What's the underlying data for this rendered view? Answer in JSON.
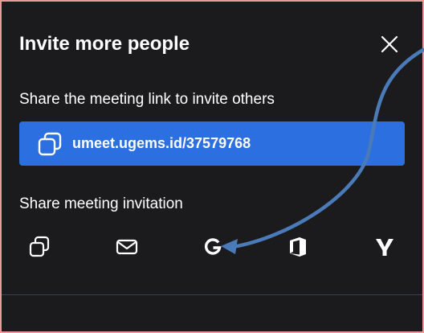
{
  "dialog": {
    "title": "Invite more people",
    "close_icon": "close-icon"
  },
  "link_section": {
    "label": "Share the meeting link to invite others",
    "url": "umeet.ugems.id/37579768",
    "copy_icon": "copy-icon"
  },
  "invite_section": {
    "label": "Share meeting invitation",
    "options": [
      {
        "icon": "copy-icon"
      },
      {
        "icon": "mail-icon"
      },
      {
        "icon": "google-icon"
      },
      {
        "icon": "office-icon"
      },
      {
        "icon": "yahoo-icon"
      }
    ]
  },
  "colors": {
    "background": "#1b1b1d",
    "link_box": "#2c6fe0",
    "annotation_arrow": "#4a7ab8",
    "frame_border": "#ea9a9a"
  }
}
